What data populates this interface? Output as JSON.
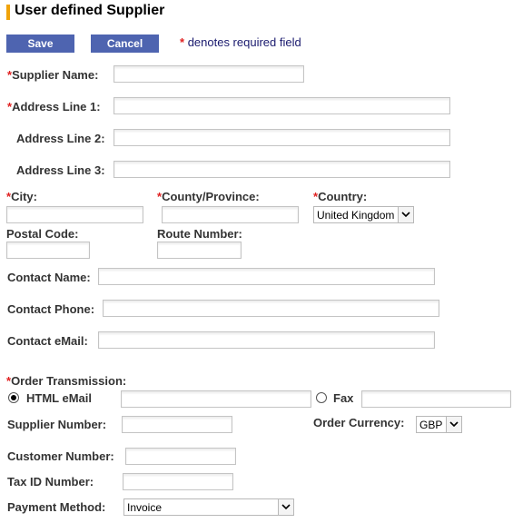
{
  "header": {
    "title": "User defined Supplier",
    "accent_color": "#f0a30a"
  },
  "toolbar": {
    "save_label": "Save",
    "cancel_label": "Cancel",
    "required_star": "*",
    "required_note": "denotes required field",
    "button_color": "#4e64b0"
  },
  "form": {
    "supplier_name": {
      "label": "Supplier Name:",
      "required": true,
      "value": ""
    },
    "address_line_1": {
      "label": "Address Line 1:",
      "required": true,
      "value": ""
    },
    "address_line_2": {
      "label": "Address Line 2:",
      "required": false,
      "value": ""
    },
    "address_line_3": {
      "label": "Address Line 3:",
      "required": false,
      "value": ""
    },
    "city": {
      "label": "City:",
      "required": true,
      "value": ""
    },
    "county": {
      "label": "County/Province:",
      "required": true,
      "value": ""
    },
    "country": {
      "label": "Country:",
      "required": true,
      "selected": "United Kingdom"
    },
    "postal_code": {
      "label": "Postal Code:",
      "required": false,
      "value": ""
    },
    "route_number": {
      "label": "Route Number:",
      "required": false,
      "value": ""
    },
    "contact_name": {
      "label": "Contact Name:",
      "value": ""
    },
    "contact_phone": {
      "label": "Contact Phone:",
      "value": ""
    },
    "contact_email": {
      "label": "Contact eMail:",
      "value": ""
    },
    "order_transmission": {
      "label": "Order Transmission:",
      "required": true,
      "options": [
        {
          "label": "HTML eMail",
          "selected": true,
          "value": ""
        },
        {
          "label": "Fax",
          "selected": false,
          "value": ""
        }
      ]
    },
    "supplier_number": {
      "label": "Supplier Number:",
      "value": ""
    },
    "order_currency": {
      "label": "Order Currency:",
      "selected": "GBP"
    },
    "customer_number": {
      "label": "Customer Number:",
      "value": ""
    },
    "tax_id_number": {
      "label": "Tax ID Number:",
      "value": ""
    },
    "payment_method": {
      "label": "Payment Method:",
      "selected": "Invoice"
    }
  }
}
